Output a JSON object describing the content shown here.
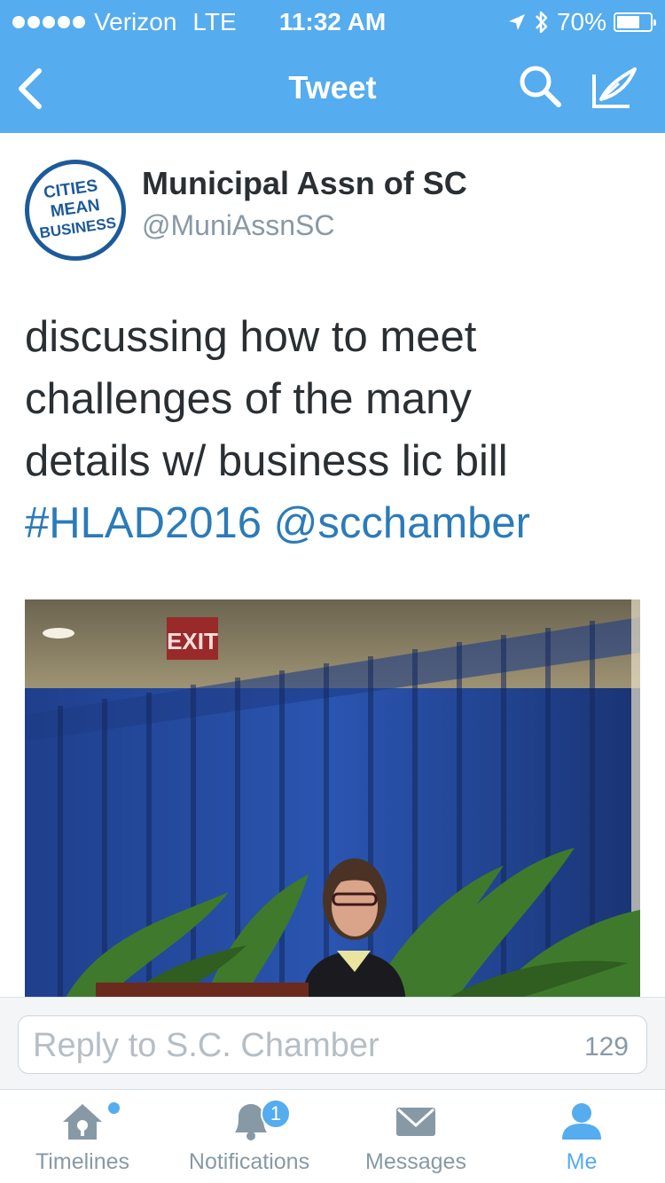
{
  "status_bar": {
    "carrier": "Verizon",
    "network": "LTE",
    "time": "11:32 AM",
    "battery_percent": "70%",
    "battery_level": 0.7,
    "icons": [
      "signal-dots-icon",
      "location-arrow-icon",
      "bluetooth-icon",
      "battery-icon"
    ]
  },
  "nav": {
    "title": "Tweet",
    "icons": [
      "back-chevron-icon",
      "search-icon",
      "compose-icon"
    ]
  },
  "tweet": {
    "author_name": "Municipal Assn of SC",
    "author_handle": "@MuniAssnSC",
    "avatar_text": [
      "CITIES",
      "MEAN",
      "BUSINESS"
    ],
    "text_line1": "discussing how to meet",
    "text_line2": "challenges of the many",
    "text_line3": "details w/ business lic bill",
    "hashtag": "#HLAD2016",
    "mention": "@scchamber",
    "photo_sign": "EXIT"
  },
  "reply": {
    "placeholder": "Reply to S.C. Chamber",
    "char_count": "129"
  },
  "tabs": [
    {
      "label": "Timelines",
      "icon": "home-icon",
      "active": false
    },
    {
      "label": "Notifications",
      "icon": "bell-icon",
      "badge": "1",
      "active": false
    },
    {
      "label": "Messages",
      "icon": "envelope-icon",
      "active": false
    },
    {
      "label": "Me",
      "icon": "person-icon",
      "active": true
    }
  ],
  "colors": {
    "brand_blue": "#55acee",
    "link_blue": "#2b7bb9",
    "text_dark": "#292f33",
    "text_gray": "#8899a6"
  }
}
